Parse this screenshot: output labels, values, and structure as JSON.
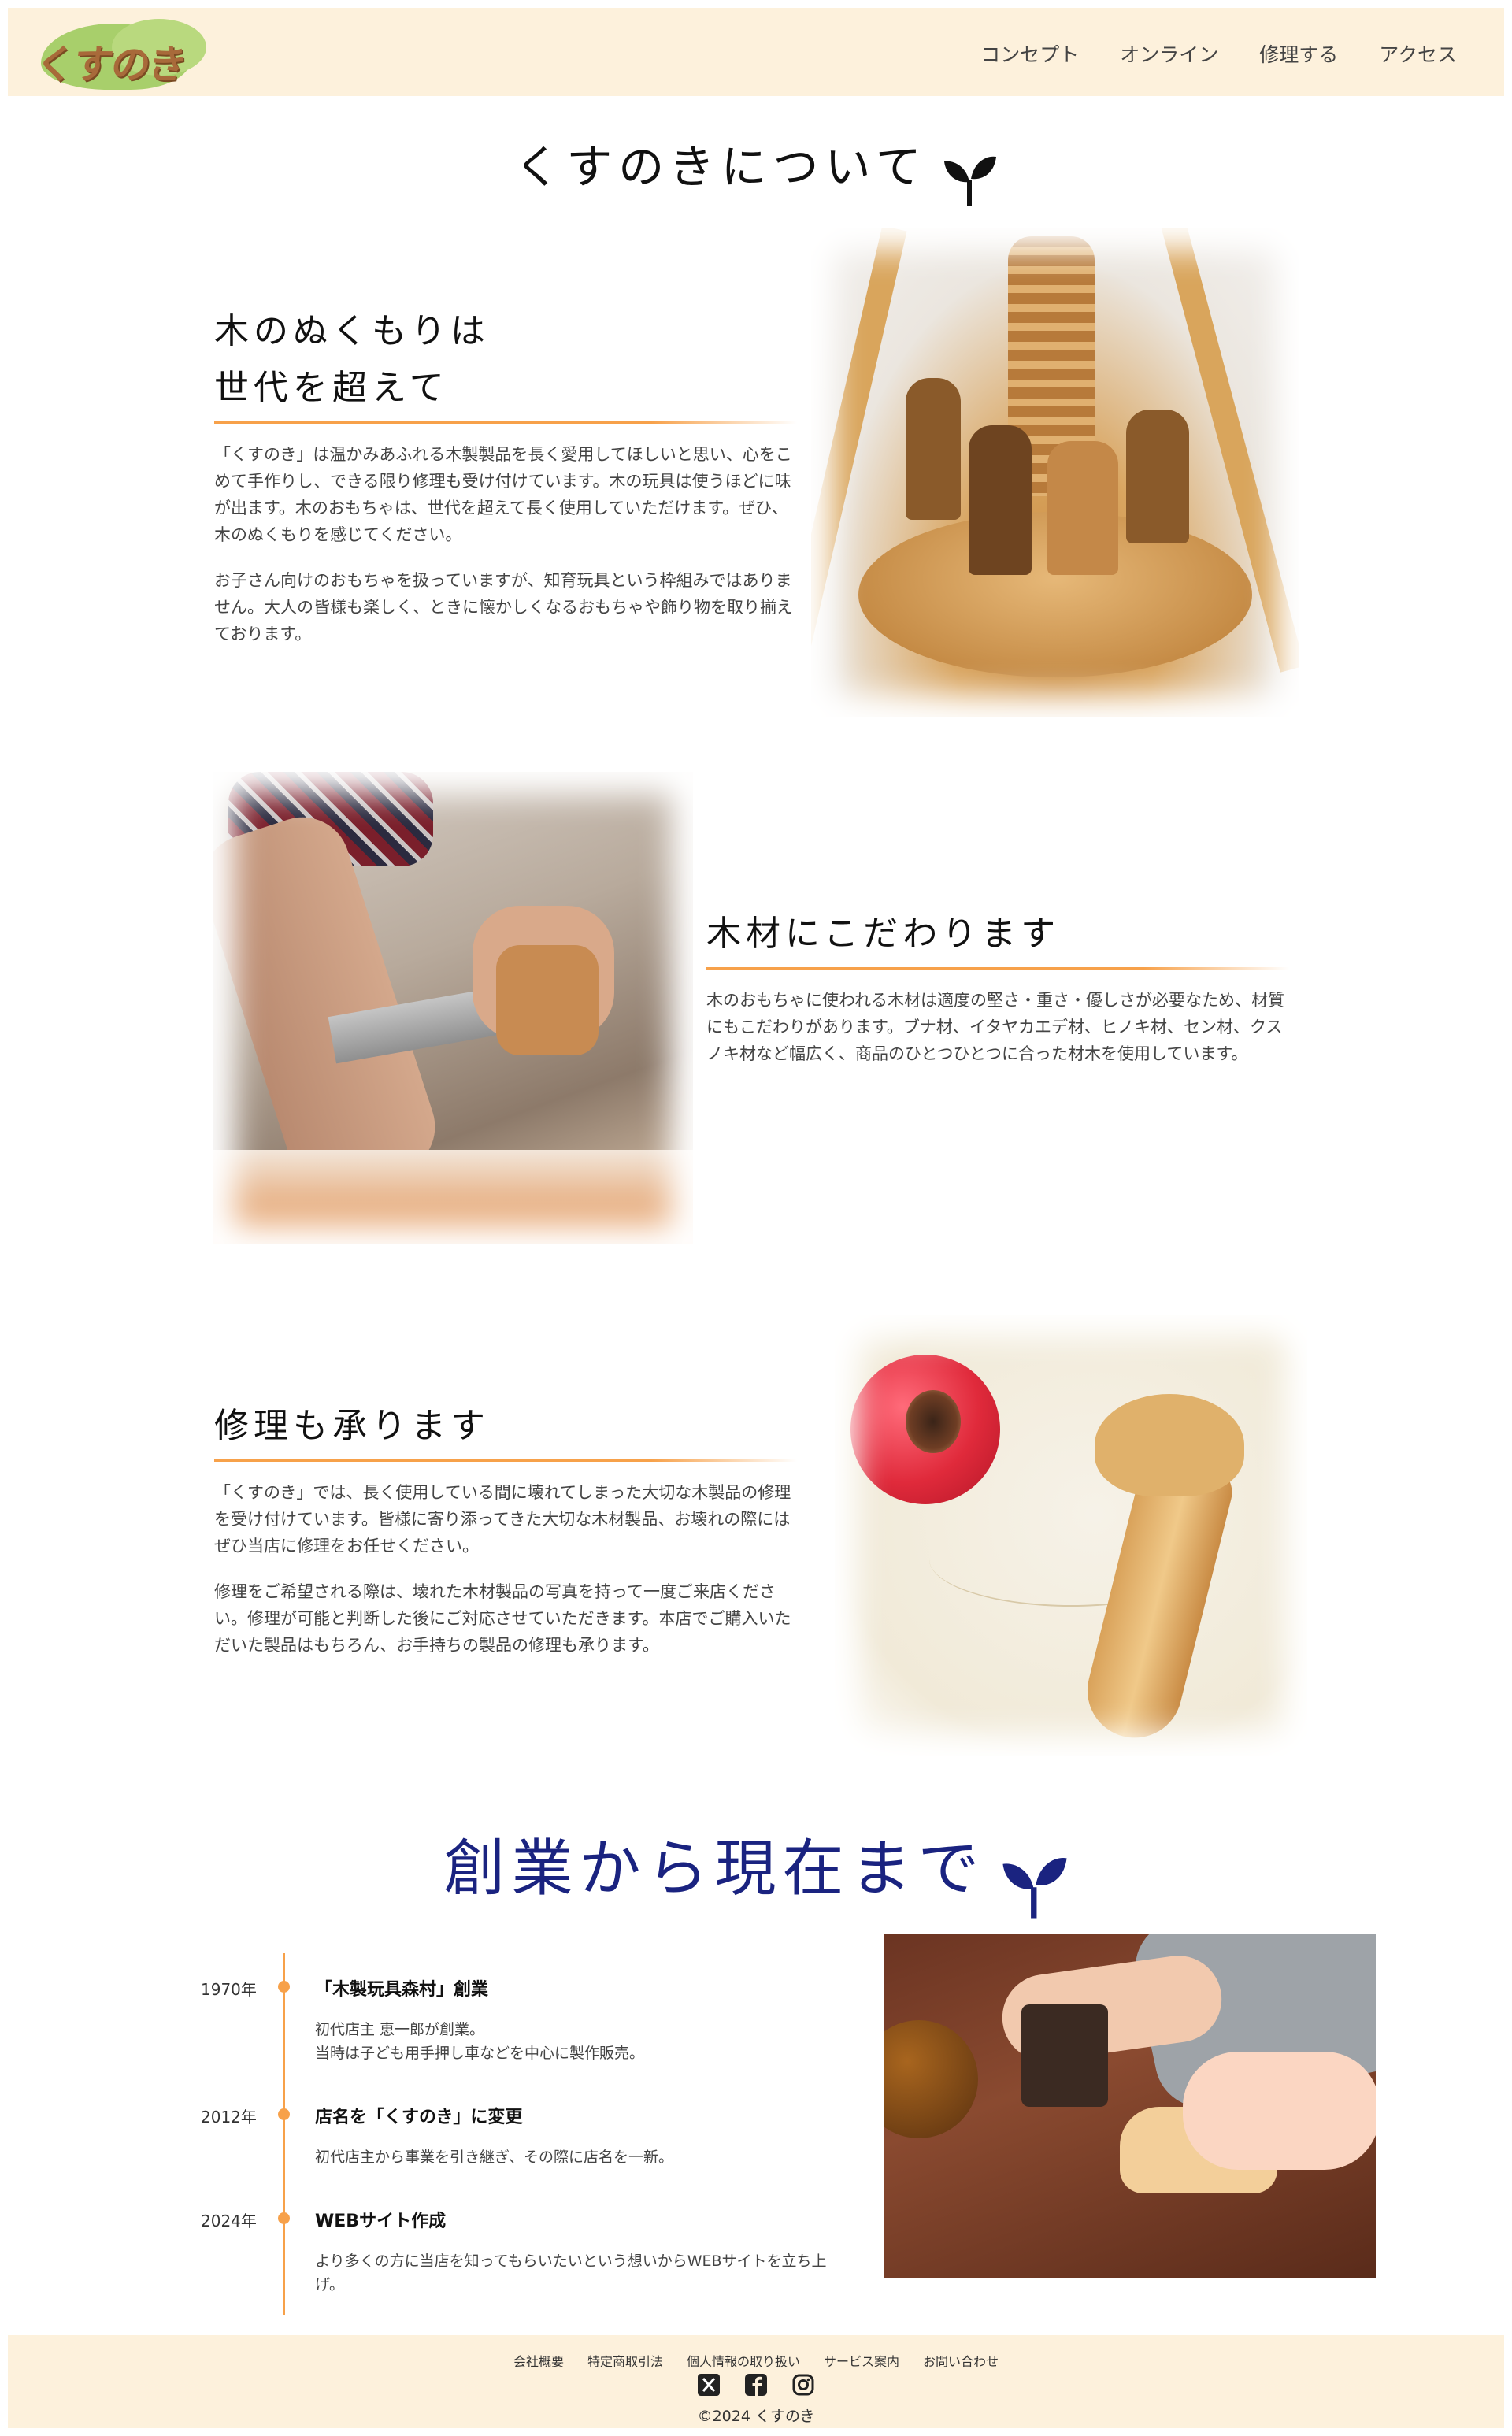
{
  "header": {
    "logo_text": "くすのき",
    "nav": [
      "コンセプト",
      "オンライン",
      "修理する",
      "アクセス"
    ]
  },
  "about": {
    "title": "くすのきについて",
    "features": [
      {
        "heading_line1": "木のぬくもりは",
        "heading_line2": "世代を超えて",
        "paragraphs": [
          "「くすのき」は温かみあふれる木製製品を長く愛用してほしいと思い、心をこめて手作りし、できる限り修理も受け付けています。木の玩具は使うほどに味が出ます。木のおもちゃは、世代を超えて長く使用していただけます。ぜひ、木のぬくもりを感じてください。",
          "お子さん向けのおもちゃを扱っていますが、知育玩具という枠組みではありません。大人の皆様も楽しく、ときに懐かしくなるおもちゃや飾り物を取り揃えております。"
        ]
      },
      {
        "heading": "木材にこだわります",
        "paragraphs": [
          "木のおもちゃに使われる木材は適度の堅さ・重さ・優しさが必要なため、材質にもこだわりがあります。ブナ材、イタヤカエデ材、ヒノキ材、セン材、クスノキ材など幅広く、商品のひとつひとつに合った材木を使用しています。"
        ]
      },
      {
        "heading": "修理も承ります",
        "paragraphs": [
          "「くすのき」では、長く使用している間に壊れてしまった大切な木製品の修理を受け付けています。皆様に寄り添ってきた大切な木材製品、お壊れの際にはぜひ当店に修理をお任せください。",
          "修理をご希望される際は、壊れた木材製品の写真を持って一度ご来店ください。修理が可能と判断した後にご対応させていただきます。本店でご購入いただいた製品はもちろん、お手持ちの製品の修理も承ります。"
        ]
      }
    ]
  },
  "history": {
    "title": "創業から現在まで",
    "items": [
      {
        "year": "1970年",
        "title": "「木製玩具森村」創業",
        "desc_line1": "初代店主 恵一郎が創業。",
        "desc_line2": "当時は子ども用手押し車などを中心に製作販売。"
      },
      {
        "year": "2012年",
        "title": "店名を「くすのき」に変更",
        "desc_line1": "初代店主から事業を引き継ぎ、その際に店名を一新。",
        "desc_line2": ""
      },
      {
        "year": "2024年",
        "title": "WEBサイト作成",
        "desc_line1": "より多くの方に当店を知ってもらいたいという想いからWEBサイトを立ち上げ。",
        "desc_line2": ""
      }
    ]
  },
  "footer": {
    "links": [
      "会社概要",
      "特定商取引法",
      "個人情報の取り扱い",
      "サービス案内",
      "お問い合わせ"
    ],
    "social_icons": [
      "x-icon",
      "facebook-icon",
      "instagram-icon"
    ],
    "copyright": "©2024 くすのき"
  },
  "colors": {
    "header_bg": "#fdf1dc",
    "accent": "#f7a14a",
    "history_title": "#1a2380"
  }
}
